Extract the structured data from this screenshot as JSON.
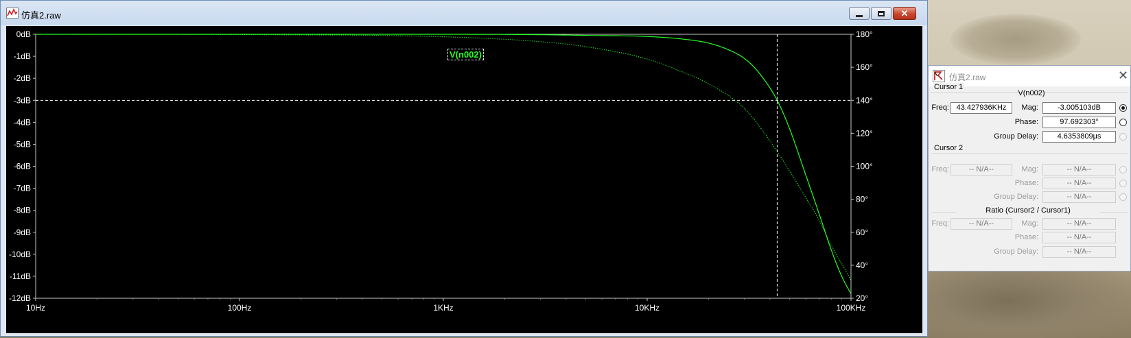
{
  "main_window": {
    "title": "仿真2.raw",
    "trace_label": "V(n002)"
  },
  "plot": {
    "y_left_ticks": [
      "0dB",
      "-1dB",
      "-2dB",
      "-3dB",
      "-4dB",
      "-5dB",
      "-6dB",
      "-7dB",
      "-8dB",
      "-9dB",
      "-10dB",
      "-11dB",
      "-12dB"
    ],
    "y_right_ticks": [
      "180°",
      "160°",
      "140°",
      "120°",
      "100°",
      "80°",
      "60°",
      "40°",
      "20°"
    ],
    "x_ticks": [
      "10Hz",
      "100Hz",
      "1KHz",
      "10KHz",
      "100KHz"
    ],
    "colors": {
      "background": "#000000",
      "trace": "#22ff22",
      "cursor": "#ffffff"
    }
  },
  "chart_data": {
    "type": "line",
    "x_scale": "log",
    "xlim": [
      10,
      100000
    ],
    "ylim_left": [
      -12,
      0
    ],
    "ylim_right": [
      20,
      180
    ],
    "grid": false,
    "series": [
      {
        "name": "V(n002)",
        "axis": "left",
        "style": "solid",
        "x": [
          10,
          100,
          1000,
          3000,
          5000,
          10000,
          15000,
          20000,
          25000,
          30000,
          35000,
          43428,
          50000,
          60000,
          70000,
          80000,
          90000,
          100000
        ],
        "y": [
          0,
          0,
          0,
          -0.02,
          -0.05,
          -0.1,
          -0.22,
          -0.4,
          -0.7,
          -1.1,
          -1.7,
          -3.0,
          -4.3,
          -6.4,
          -8.2,
          -9.8,
          -11.0,
          -11.8
        ]
      },
      {
        "axis": "right",
        "style": "dotted",
        "x": [
          10,
          100,
          1000,
          3000,
          5000,
          10000,
          15000,
          20000,
          30000,
          43428,
          50000,
          60000,
          70000,
          80000,
          90000,
          100000
        ],
        "y": [
          180,
          179.8,
          178.5,
          175.5,
          172.5,
          165,
          157,
          150,
          135,
          109,
          97,
          81,
          67,
          52,
          41,
          31
        ]
      }
    ],
    "cursor": {
      "x": 43427.936,
      "y": -3.005103
    }
  },
  "cursor_dialog": {
    "title": "仿真2.raw",
    "cursor1": {
      "group_label": "Cursor 1",
      "trace": "V(n002)",
      "freq_label": "Freq:",
      "freq": "43.427936KHz",
      "mag_label": "Mag:",
      "mag": "-3.005103dB",
      "phase_label": "Phase:",
      "phase": "97.692303°",
      "gd_label": "Group Delay:",
      "gd": "4.6353809µs"
    },
    "cursor2": {
      "group_label": "Cursor 2",
      "freq_label": "Freq:",
      "freq": "-- N/A--",
      "mag_label": "Mag:",
      "mag": "-- N/A--",
      "phase_label": "Phase:",
      "phase": "-- N/A--",
      "gd_label": "Group Delay:",
      "gd": "-- N/A--"
    },
    "ratio": {
      "group_label": "Ratio (Cursor2 / Cursor1)",
      "freq_label": "Freq:",
      "freq": "-- N/A--",
      "mag_label": "Mag:",
      "mag": "-- N/A--",
      "phase_label": "Phase:",
      "phase": "-- N/A--",
      "gd_label": "Group Delay:",
      "gd": "-- N/A--"
    }
  }
}
